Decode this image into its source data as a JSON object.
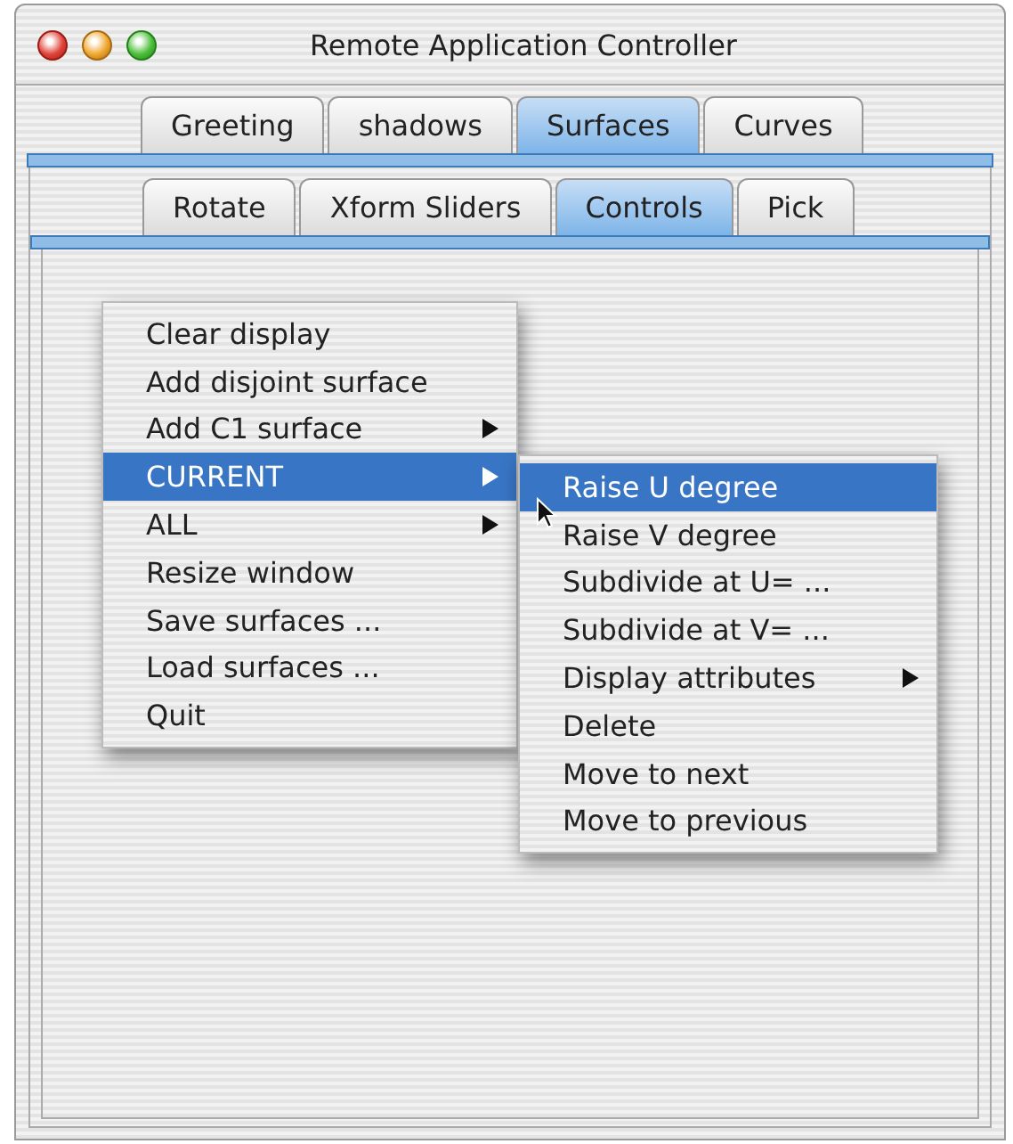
{
  "window": {
    "title": "Remote Application Controller"
  },
  "tabs": [
    {
      "label": "Greeting",
      "selected": false
    },
    {
      "label": "shadows",
      "selected": false
    },
    {
      "label": "Surfaces",
      "selected": true
    },
    {
      "label": "Curves",
      "selected": false
    }
  ],
  "subtabs": [
    {
      "label": "Rotate",
      "selected": false
    },
    {
      "label": "Xform Sliders",
      "selected": false
    },
    {
      "label": "Controls",
      "selected": true
    },
    {
      "label": "Pick",
      "selected": false
    }
  ],
  "menu": {
    "items": [
      {
        "label": "Clear display",
        "submenu": false,
        "selected": false
      },
      {
        "label": "Add disjoint surface",
        "submenu": false,
        "selected": false
      },
      {
        "label": "Add C1 surface",
        "submenu": true,
        "selected": false
      },
      {
        "label": "CURRENT",
        "submenu": true,
        "selected": true
      },
      {
        "label": "ALL",
        "submenu": true,
        "selected": false
      },
      {
        "label": "Resize window",
        "submenu": false,
        "selected": false
      },
      {
        "label": "Save surfaces ...",
        "submenu": false,
        "selected": false
      },
      {
        "label": "Load surfaces ...",
        "submenu": false,
        "selected": false
      },
      {
        "label": "Quit",
        "submenu": false,
        "selected": false
      }
    ]
  },
  "submenu": {
    "items": [
      {
        "label": "Raise U degree",
        "submenu": false,
        "selected": true
      },
      {
        "label": "Raise V degree",
        "submenu": false,
        "selected": false
      },
      {
        "label": "Subdivide at U= ...",
        "submenu": false,
        "selected": false
      },
      {
        "label": "Subdivide at V= ...",
        "submenu": false,
        "selected": false
      },
      {
        "label": "Display attributes",
        "submenu": true,
        "selected": false
      },
      {
        "label": "Delete",
        "submenu": false,
        "selected": false
      },
      {
        "label": "Move to next",
        "submenu": false,
        "selected": false
      },
      {
        "label": "Move to previous",
        "submenu": false,
        "selected": false
      }
    ]
  }
}
